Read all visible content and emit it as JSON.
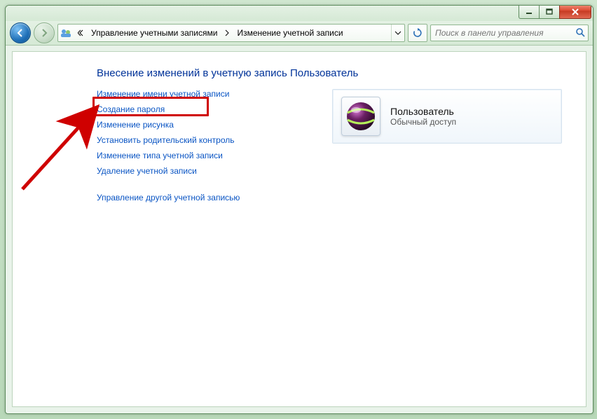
{
  "breadcrumb": {
    "seg1": "Управление учетными записями",
    "seg2": "Изменение учетной записи"
  },
  "search": {
    "placeholder": "Поиск в панели управления"
  },
  "heading": "Внесение изменений в учетную запись Пользователь",
  "tasks": {
    "change_name": "Изменение имени учетной записи",
    "create_password": "Создание пароля",
    "change_picture": "Изменение рисунка",
    "parental_controls": "Установить родительский контроль",
    "change_type": "Изменение типа учетной записи",
    "delete_account": "Удаление учетной записи",
    "manage_other": "Управление другой учетной записью"
  },
  "account": {
    "name": "Пользователь",
    "type": "Обычный доступ"
  }
}
